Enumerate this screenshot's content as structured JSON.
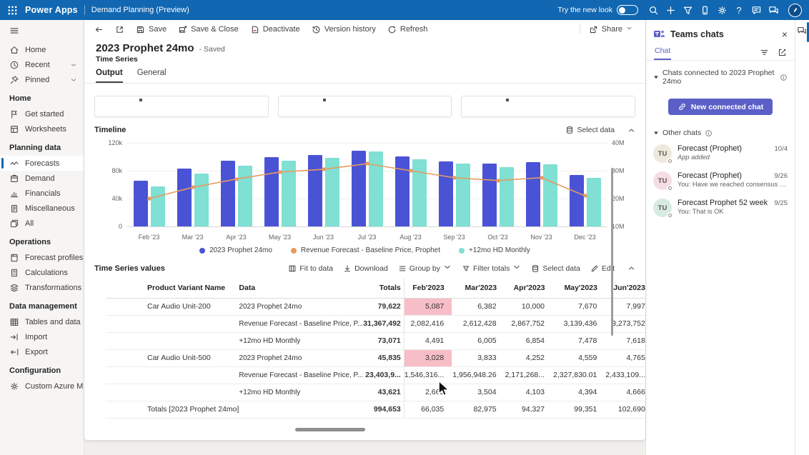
{
  "topbar": {
    "app": "Power Apps",
    "env": "Demand Planning (Preview)",
    "new_look_label": "Try the new look",
    "actions": [
      "search-icon",
      "add-icon",
      "filter-icon",
      "mobile-icon",
      "settings-icon",
      "help-icon",
      "feedback-icon",
      "teams-chat-icon"
    ]
  },
  "sidebar": {
    "top_items": [
      {
        "icon": "home",
        "label": "Home"
      },
      {
        "icon": "recent",
        "label": "Recent",
        "chevron": true
      },
      {
        "icon": "pinned",
        "label": "Pinned",
        "chevron": true
      }
    ],
    "groups": [
      {
        "header": "Home",
        "items": [
          {
            "icon": "get-started",
            "label": "Get started"
          },
          {
            "icon": "worksheets",
            "label": "Worksheets"
          }
        ]
      },
      {
        "header": "Planning data",
        "items": [
          {
            "icon": "forecasts",
            "label": "Forecasts",
            "selected": true
          },
          {
            "icon": "demand",
            "label": "Demand"
          },
          {
            "icon": "financials",
            "label": "Financials"
          },
          {
            "icon": "miscellaneous",
            "label": "Miscellaneous"
          },
          {
            "icon": "all",
            "label": "All"
          }
        ]
      },
      {
        "header": "Operations",
        "items": [
          {
            "icon": "forecast-profiles",
            "label": "Forecast profiles"
          },
          {
            "icon": "calculations",
            "label": "Calculations"
          },
          {
            "icon": "transformations",
            "label": "Transformations"
          }
        ]
      },
      {
        "header": "Data management",
        "items": [
          {
            "icon": "tables",
            "label": "Tables and data"
          },
          {
            "icon": "import",
            "label": "Import"
          },
          {
            "icon": "export",
            "label": "Export"
          }
        ]
      },
      {
        "header": "Configuration",
        "items": [
          {
            "icon": "azure-ml",
            "label": "Custom Azure ML"
          }
        ]
      }
    ]
  },
  "commandbar": {
    "items": [
      {
        "icon": "back",
        "name": "back-button"
      },
      {
        "icon": "popout",
        "name": "expand-button"
      },
      {
        "icon": "save",
        "label": "Save"
      },
      {
        "icon": "save-close",
        "label": "Save & Close"
      },
      {
        "icon": "deactivate",
        "label": "Deactivate"
      },
      {
        "icon": "history",
        "label": "Version history"
      },
      {
        "icon": "refresh",
        "label": "Refresh"
      }
    ],
    "share": {
      "icon": "share",
      "label": "Share",
      "chevron": true
    }
  },
  "page": {
    "title": "2023 Prophet 24mo",
    "saved_label": "- Saved",
    "subtitle": "Time Series",
    "tabs": [
      {
        "label": "Output",
        "active": true
      },
      {
        "label": "General"
      }
    ]
  },
  "timeline": {
    "header": "Timeline",
    "actions": [
      {
        "icon": "select-data",
        "label": "Select data"
      }
    ]
  },
  "chart_data": {
    "type": "bar+line",
    "title": "Timeline",
    "categories": [
      "Feb '23",
      "Mar '23",
      "Apr '23",
      "May '23",
      "Jun '23",
      "Jul '23",
      "Aug '23",
      "Sep '23",
      "Oct '23",
      "Nov '23",
      "Dec '23"
    ],
    "series": [
      {
        "name": "2023 Prophet 24mo",
        "type": "bar",
        "axis": "left",
        "color": "#4a53d5",
        "values": [
          66035,
          82975,
          94327,
          99351,
          102690,
          109000,
          100500,
          93500,
          90000,
          92500,
          73500
        ]
      },
      {
        "name": "Revenue Forecast - Baseline Price, Prophet",
        "type": "line",
        "axis": "right",
        "color": "#e79b61",
        "values": [
          20000000,
          24000000,
          27000000,
          29500000,
          30500000,
          32500000,
          30000000,
          27500000,
          26500000,
          27500000,
          21000000
        ]
      },
      {
        "name": "+12mo HD Monthly",
        "type": "bar",
        "axis": "left",
        "color": "#7fe0d3",
        "values": [
          57000,
          76000,
          87000,
          94000,
          98000,
          108000,
          96500,
          90000,
          85500,
          89000,
          70000
        ]
      }
    ],
    "left_axis": {
      "ticks": [
        "0",
        "40k",
        "80k",
        "120k"
      ],
      "min": 0,
      "max": 120000
    },
    "right_axis": {
      "ticks": [
        "10M",
        "20M",
        "30M",
        "40M"
      ],
      "min": 10000000,
      "max": 40000000
    },
    "legend_position": "bottom",
    "grid": true
  },
  "values_table": {
    "header": "Time Series values",
    "actions": [
      {
        "icon": "fit",
        "label": "Fit to data"
      },
      {
        "icon": "download",
        "label": "Download"
      },
      {
        "icon": "group",
        "label": "Group by",
        "chevron": true
      },
      {
        "icon": "filter-totals",
        "label": "Filter totals",
        "chevron": true
      },
      {
        "icon": "select-data",
        "label": "Select data"
      },
      {
        "icon": "edit",
        "label": "Edit"
      }
    ],
    "columns": [
      "Product Variant Name",
      "Data",
      "Totals",
      "Feb'2023",
      "Mar'2023",
      "Apr'2023",
      "May'2023",
      "Jun'2023"
    ],
    "rows": [
      {
        "product": "Car Audio Unit-200",
        "data": "2023 Prophet 24mo",
        "totals": "79,622",
        "cells": [
          "5,087",
          "6,382",
          "10,000",
          "7,670",
          "7,997"
        ],
        "highlight": [
          0
        ]
      },
      {
        "product": "",
        "data": "Revenue Forecast - Baseline Price, P...",
        "totals": "31,367,492",
        "cells": [
          "2,082,416",
          "2,612,428",
          "2,867,752",
          "3,139,436",
          "3,273,752"
        ],
        "highlight": []
      },
      {
        "product": "",
        "data": "+12mo HD Monthly",
        "totals": "73,071",
        "cells": [
          "4,491",
          "6,005",
          "6,854",
          "7,478",
          "7,618"
        ],
        "highlight": []
      },
      {
        "product": "Car Audio Unit-500",
        "data": "2023 Prophet 24mo",
        "totals": "45,835",
        "cells": [
          "3,028",
          "3,833",
          "4,252",
          "4,559",
          "4,765"
        ],
        "highlight": [
          0
        ]
      },
      {
        "product": "",
        "data": "Revenue Forecast - Baseline Price, P...",
        "totals": "23,403,9...",
        "cells": [
          "1,546,316...",
          "1,956,948.26",
          "2,171,268...",
          "2,327,830.01",
          "2,433,109..."
        ],
        "highlight": []
      },
      {
        "product": "",
        "data": "+12mo HD Monthly",
        "totals": "43,621",
        "cells": [
          "2,665",
          "3,504",
          "4,103",
          "4,394",
          "4,666"
        ],
        "highlight": []
      },
      {
        "product": "Totals [2023 Prophet 24mo]",
        "data": "",
        "totals": "994,653",
        "cells": [
          "66,035",
          "82,975",
          "94,327",
          "99,351",
          "102,690"
        ],
        "highlight": [],
        "is_totals": true
      }
    ]
  },
  "teams": {
    "title": "Teams chats",
    "tab": "Chat",
    "connected_header": "Chats connected to 2023 Prophet 24mo",
    "new_chat_button": "New connected chat",
    "other_header": "Other chats",
    "accent_color": "#5b5fc7",
    "chats": [
      {
        "initials": "TU",
        "avatar_color": "#efe8dd",
        "name": "Forecast (Prophet)",
        "preview": "App added",
        "date": "10/4",
        "italic": true
      },
      {
        "initials": "TU",
        "avatar_color": "#f5dee3",
        "name": "Forecast (Prophet)",
        "preview": "You: Have we reached consensus on the Octo...",
        "date": "9/26",
        "italic": false
      },
      {
        "initials": "TU",
        "avatar_color": "#d7ece1",
        "name": "Forecast Prophet 52 week",
        "preview": "You: That is OK",
        "date": "9/25",
        "italic": false
      }
    ]
  }
}
